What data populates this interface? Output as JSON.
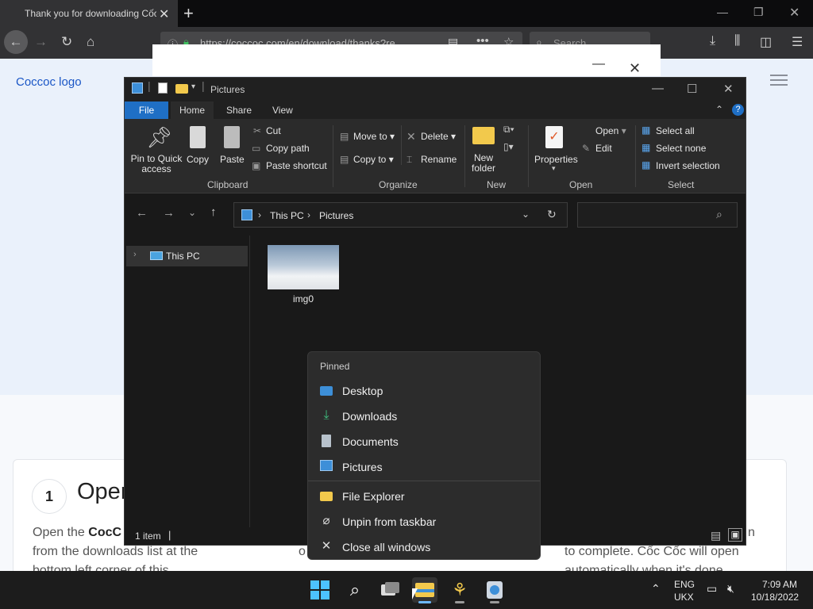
{
  "browser": {
    "tab_title": "Thank you for downloading Cốc Cốc",
    "url": "https://coccoc.com/en/download/thanks?re",
    "url_domain": "coccoc.com",
    "search_placeholder": "Search",
    "page": {
      "logo": "Coccoc logo",
      "step_number": "1",
      "step_title": "Open",
      "step_left_line1_prefix": "Open the ",
      "step_left_line1_bold": "CocC",
      "step_left_line2": "from the downloads list at the",
      "step_left_line3": "bottom left corner of this",
      "step_mid_line": "o",
      "step_right_line1": "n",
      "step_right_line2": "to complete. Cốc Cốc will open",
      "step_right_line3": "automatically when it's done"
    }
  },
  "explorer": {
    "title": "Pictures",
    "tabs": [
      "File",
      "Home",
      "Share",
      "View"
    ],
    "ribbon": {
      "pin_label_1": "Pin to Quick",
      "pin_label_2": "access",
      "copy": "Copy",
      "paste": "Paste",
      "cut": "Cut",
      "copy_path": "Copy path",
      "paste_shortcut": "Paste shortcut",
      "move_to": "Move to",
      "copy_to": "Copy to",
      "delete": "Delete",
      "rename": "Rename",
      "new_folder_1": "New",
      "new_folder_2": "folder",
      "properties": "Properties",
      "open": "Open",
      "edit": "Edit",
      "select_all": "Select all",
      "select_none": "Select none",
      "invert_selection": "Invert selection",
      "groups": [
        "Clipboard",
        "Organize",
        "New",
        "Open",
        "Select"
      ]
    },
    "breadcrumb": [
      "This PC",
      "Pictures"
    ],
    "nav_item": "This PC",
    "file_name": "img0",
    "status": "1 item"
  },
  "jumplist": {
    "header": "Pinned",
    "pinned": [
      {
        "label": "Desktop",
        "icon": "desktop-icon"
      },
      {
        "label": "Downloads",
        "icon": "download-icon"
      },
      {
        "label": "Documents",
        "icon": "document-icon"
      },
      {
        "label": "Pictures",
        "icon": "pictures-icon"
      }
    ],
    "actions": [
      {
        "label": "File Explorer",
        "icon": "folder-icon"
      },
      {
        "label": "Unpin from taskbar",
        "icon": "unpin-icon"
      },
      {
        "label": "Close all windows",
        "icon": "close-icon"
      }
    ]
  },
  "taskbar": {
    "lang_1": "ENG",
    "lang_2": "UKX",
    "time": "7:09 AM",
    "date": "10/18/2022"
  },
  "colors": {
    "accent": "#1f6fc5",
    "folder": "#f2c94c",
    "link_blue": "#1a56c6"
  }
}
